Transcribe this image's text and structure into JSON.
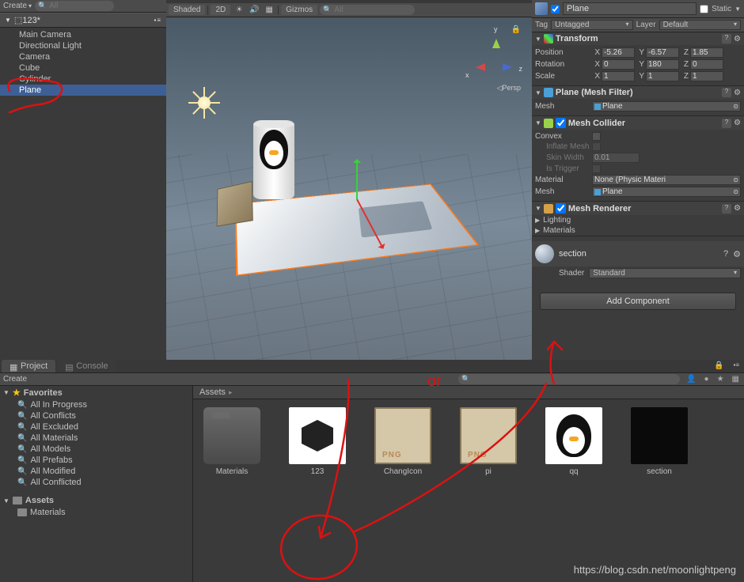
{
  "hierarchy": {
    "create_label": "Create",
    "search_placeholder": "All",
    "scene_name": "123*",
    "items": [
      "Main Camera",
      "Directional Light",
      "Camera",
      "Cube",
      "Cylinder",
      "Plane"
    ]
  },
  "viewport": {
    "shading": "Shaded",
    "mode_2d": "2D",
    "gizmos": "Gizmos",
    "search_placeholder": "All",
    "persp_label": "Persp",
    "axis_x": "x",
    "axis_y": "y",
    "axis_z": "z"
  },
  "inspector": {
    "name": "Plane",
    "static_label": "Static",
    "tag_label": "Tag",
    "tag_value": "Untagged",
    "layer_label": "Layer",
    "layer_value": "Default",
    "transform": {
      "title": "Transform",
      "position_label": "Position",
      "pos": {
        "x": "-5.26",
        "y": "-6.57",
        "z": "1.85"
      },
      "rotation_label": "Rotation",
      "rot": {
        "x": "0",
        "y": "180",
        "z": "0"
      },
      "scale_label": "Scale",
      "scl": {
        "x": "1",
        "y": "1",
        "z": "1"
      }
    },
    "mesh_filter": {
      "title": "Plane (Mesh Filter)",
      "mesh_label": "Mesh",
      "mesh_value": "Plane"
    },
    "mesh_collider": {
      "title": "Mesh Collider",
      "convex_label": "Convex",
      "inflate_label": "Inflate Mesh",
      "skinwidth_label": "Skin Width",
      "skinwidth_value": "0.01",
      "trigger_label": "Is Trigger",
      "material_label": "Material",
      "material_value": "None (Physic Materi",
      "mesh_label": "Mesh",
      "mesh_value": "Plane"
    },
    "mesh_renderer": {
      "title": "Mesh Renderer",
      "lighting": "Lighting",
      "materials": "Materials"
    },
    "material": {
      "name": "section",
      "shader_label": "Shader",
      "shader_value": "Standard"
    },
    "add_component": "Add Component"
  },
  "project": {
    "tab_project": "Project",
    "tab_console": "Console",
    "create_label": "Create",
    "favorites_label": "Favorites",
    "favorites": [
      "All In Progress",
      "All Conflicts",
      "All Excluded",
      "All Materials",
      "All Models",
      "All Prefabs",
      "All Modified",
      "All Conflicted"
    ],
    "assets_label": "Assets",
    "folders": [
      "Materials"
    ],
    "crumb": "Assets",
    "assets": [
      {
        "name": "Materials",
        "kind": "folder"
      },
      {
        "name": "123",
        "kind": "unity"
      },
      {
        "name": "ChangIcon",
        "kind": "img"
      },
      {
        "name": "pi",
        "kind": "img"
      },
      {
        "name": "qq",
        "kind": "qq"
      },
      {
        "name": "section",
        "kind": "black"
      }
    ]
  },
  "annotation_text": "or",
  "watermark": "https://blog.csdn.net/moonlightpeng"
}
